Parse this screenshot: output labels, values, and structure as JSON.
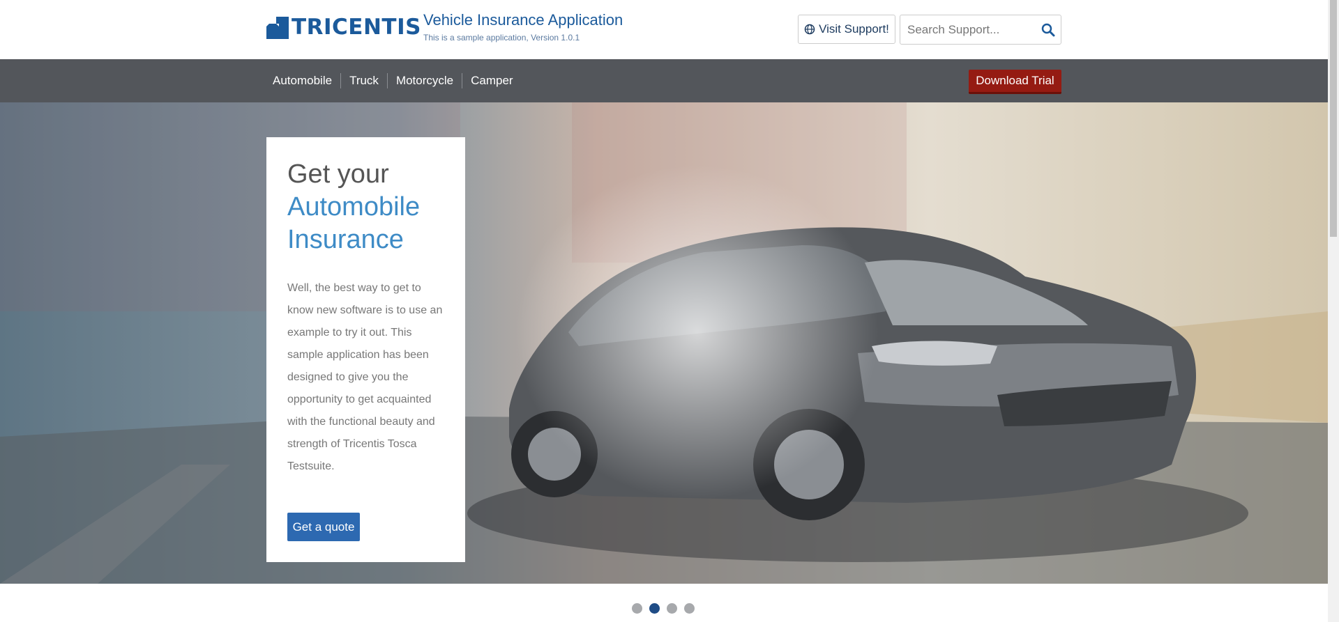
{
  "header": {
    "logo_text": "TRICENTIS",
    "app_title": "Vehicle Insurance Application",
    "app_subtitle": "This is a sample application, Version 1.0.1",
    "support_label": "Visit Support!",
    "search_placeholder": "Search Support...",
    "icons": {
      "support": "globe-icon",
      "search": "search-icon"
    }
  },
  "nav": {
    "items": [
      {
        "label": "Automobile"
      },
      {
        "label": "Truck"
      },
      {
        "label": "Motorcycle"
      },
      {
        "label": "Camper"
      }
    ],
    "trial_label": "Download Trial"
  },
  "hero": {
    "title_prefix": "Get your",
    "title_accent": "Automobile",
    "title_suffix": "Insurance",
    "body": "Well, the best way to get to know new software is to use an example to try it out. This sample application has been designed to give you the opportunity to get acquainted with the functional beauty and strength of Tricentis Tosca Testsuite.",
    "cta_label": "Get a quote"
  },
  "carousel": {
    "slide_count": 4,
    "active_slide": 2
  },
  "colors": {
    "brand": "#1b5a9b",
    "nav_bg": "#53565b",
    "trial": "#951b12",
    "cta": "#2d69b1",
    "accent_text": "#3e8bc6"
  }
}
